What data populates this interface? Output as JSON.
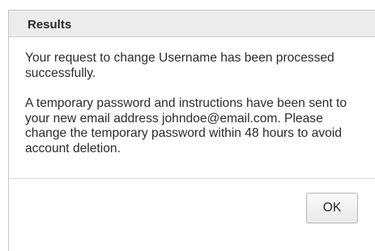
{
  "dialog": {
    "title": "Results",
    "message_1": "Your request to change Username has been processed successfully.",
    "message_2": "A temporary password and instructions have been sent to your new email address johndoe@email.com. Please change the temporary password within 48 hours to avoid account deletion.",
    "ok_label": "OK"
  }
}
